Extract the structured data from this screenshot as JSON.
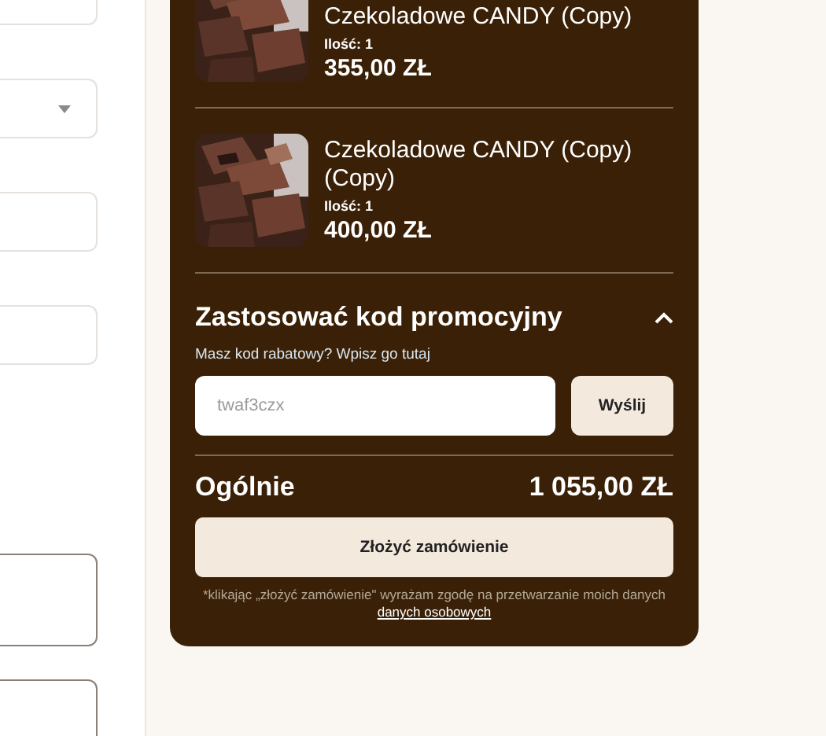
{
  "form_fields": [
    {
      "kind": "text"
    },
    {
      "kind": "select"
    },
    {
      "kind": "text"
    },
    {
      "kind": "text"
    },
    {
      "kind": "textarea"
    },
    {
      "kind": "textarea"
    }
  ],
  "cart": {
    "items": [
      {
        "kind": "picture",
        "title": "Czekoladowe CANDY (Copy)",
        "quantity": "Ilość: 1",
        "price": "355,00 ZŁ"
      },
      {
        "kind": "picture",
        "title": "Czekoladowe CANDY (Copy) (Copy)",
        "quantity": "Ilość: 1",
        "price": "400,00 ZŁ"
      }
    ],
    "promo": {
      "title": "Zastosować kod promocyjny",
      "expanded": true,
      "hint": "Masz kod rabatowy? Wpisz go tutaj",
      "placeholder": "twaf3czx",
      "button": "Wyślij"
    },
    "total": {
      "label": "Ogólnie",
      "value": "1 055,00 ZŁ"
    },
    "submit": "Złożyć zamówienie",
    "consent": {
      "text": "*klikając „złożyć zamówienie\" wyrażam zgodę na przetwarzanie moich danych",
      "link": "danych osobowych"
    }
  }
}
